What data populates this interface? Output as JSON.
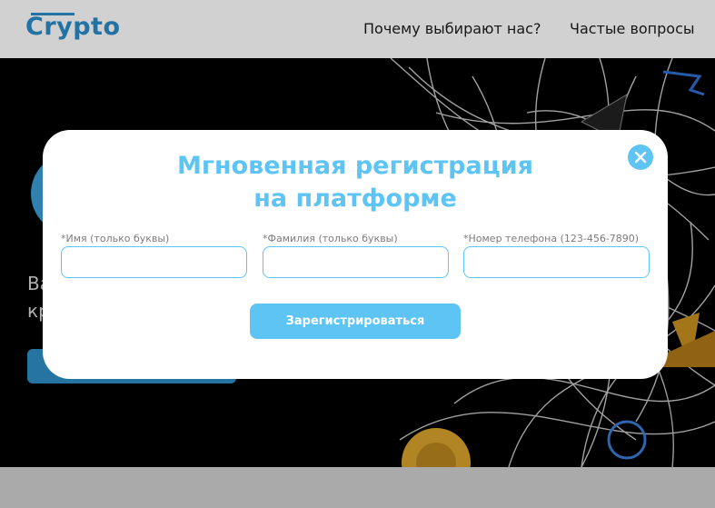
{
  "header": {
    "logo": "Crypto",
    "nav": [
      {
        "label": "Почему выбирают нас?"
      },
      {
        "label": "Частые вопросы"
      }
    ]
  },
  "hero": {
    "text_line1": "Ва",
    "text_line2": "кр"
  },
  "modal": {
    "title_line1": "Мгновенная регистрация",
    "title_line2": "на платформе",
    "fields": [
      {
        "label": "*Имя (только буквы)",
        "value": ""
      },
      {
        "label": "*Фамилия (только буквы)",
        "value": ""
      },
      {
        "label": "*Номер телефона (123-456-7890)",
        "value": ""
      }
    ],
    "submit_label": "Зарегистрироваться"
  },
  "colors": {
    "accent": "#5ec4f4",
    "brand": "#2a8bc9",
    "hero_bg": "#000000"
  }
}
